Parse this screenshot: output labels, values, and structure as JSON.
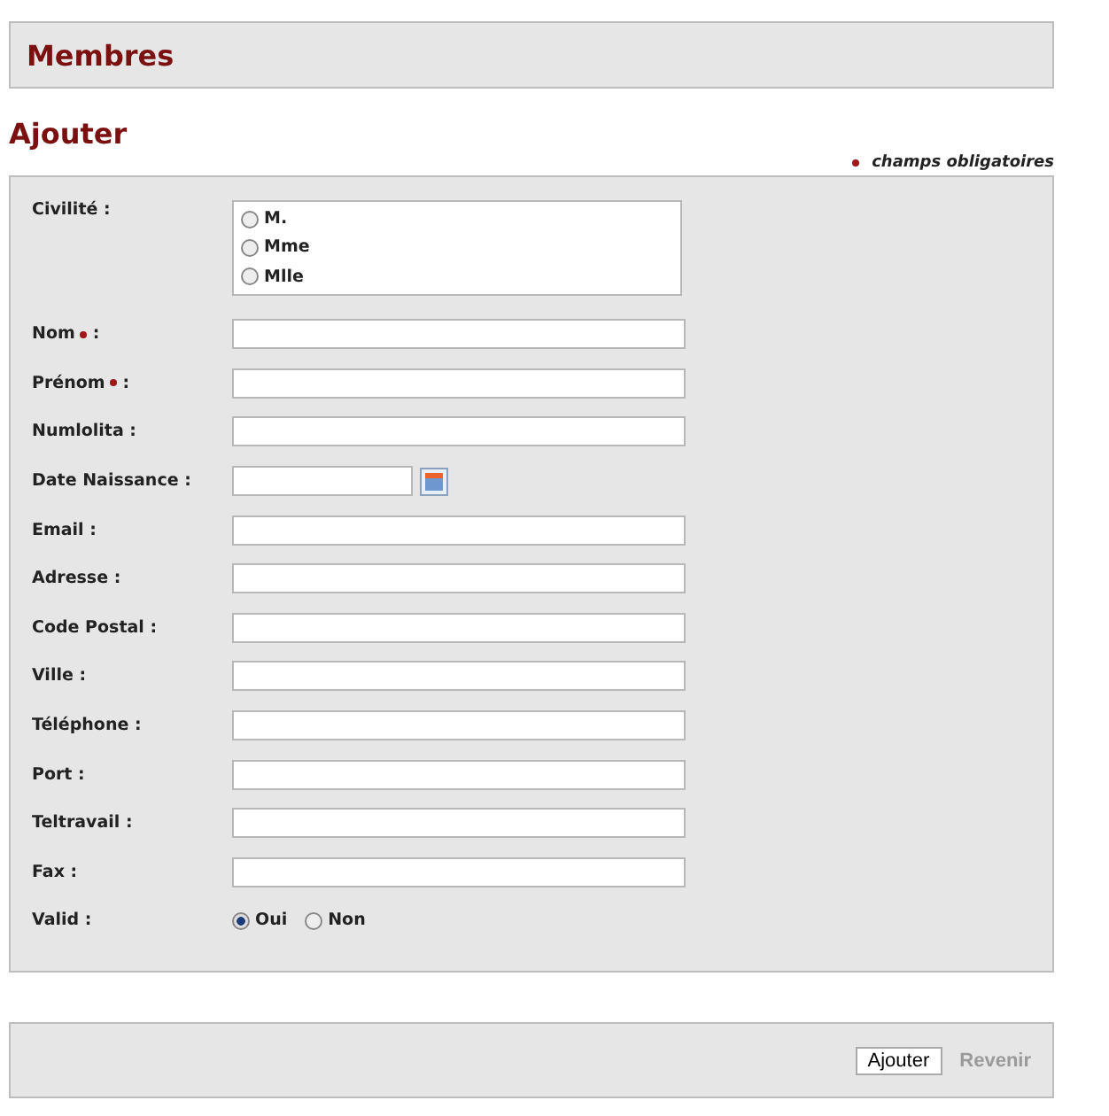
{
  "header": {
    "title": "Membres"
  },
  "section": {
    "title": "Ajouter",
    "required_note": "champs obligatoires"
  },
  "form": {
    "fields": [
      {
        "kind": "radio_group",
        "label": "Civilité :",
        "options": [
          {
            "label": "M.",
            "selected": false
          },
          {
            "label": "Mme",
            "selected": false
          },
          {
            "label": "Mlle",
            "selected": false
          }
        ]
      },
      {
        "kind": "text",
        "label": "Nom",
        "required": true,
        "suffix": ":"
      },
      {
        "kind": "text",
        "label": "Prénom",
        "required": true,
        "suffix": ":"
      },
      {
        "kind": "text",
        "label": "Numlolita :"
      },
      {
        "kind": "date",
        "label": "Date Naissance :"
      },
      {
        "kind": "text",
        "label": "Email :"
      },
      {
        "kind": "text",
        "label": "Adresse :"
      },
      {
        "kind": "text",
        "label": "Code Postal :"
      },
      {
        "kind": "text",
        "label": "Ville :"
      },
      {
        "kind": "text",
        "label": "Téléphone :"
      },
      {
        "kind": "text",
        "label": "Port :"
      },
      {
        "kind": "text",
        "label": "Teltravail :"
      },
      {
        "kind": "text",
        "label": "Fax :"
      },
      {
        "kind": "radio_inline",
        "label": "Valid :",
        "options": [
          {
            "label": "Oui",
            "selected": true
          },
          {
            "label": "Non",
            "selected": false
          }
        ]
      }
    ]
  },
  "buttons": [
    {
      "label": "Ajouter",
      "disabled": false
    },
    {
      "label": "Revenir",
      "disabled": true
    }
  ]
}
